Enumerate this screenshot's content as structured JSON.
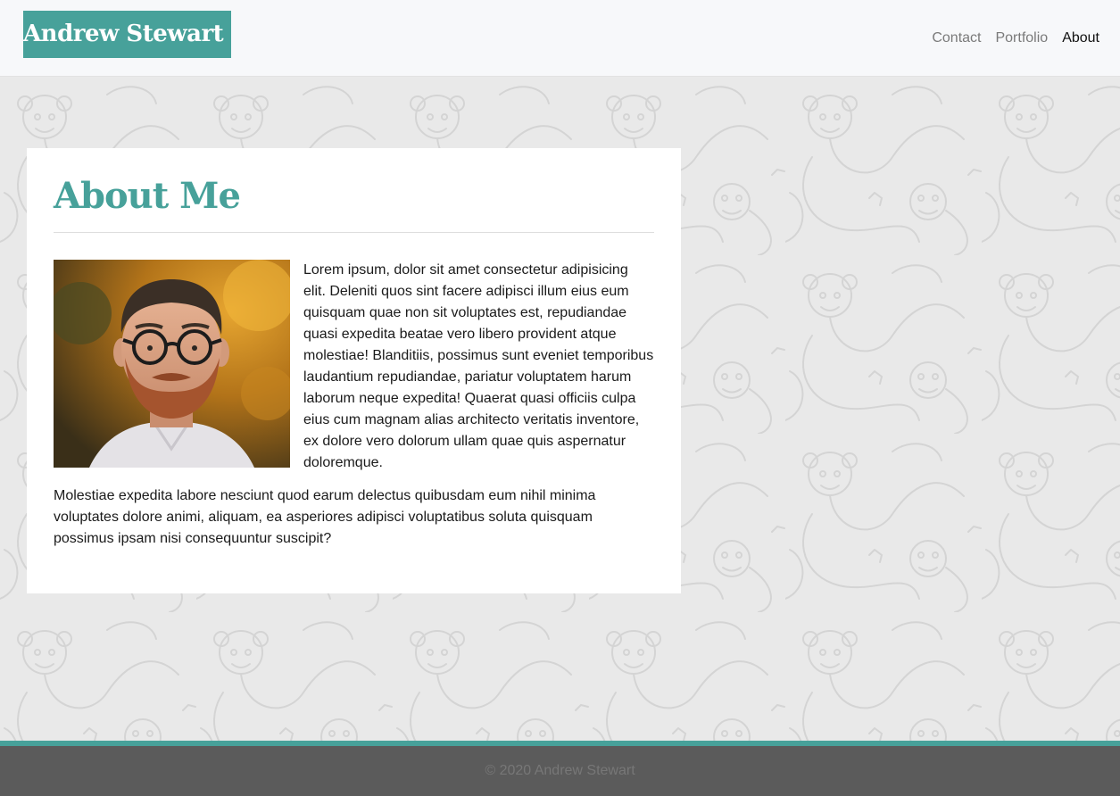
{
  "header": {
    "brand": "Andrew Stewart",
    "nav": [
      {
        "label": "Contact"
      },
      {
        "label": "Portfolio"
      },
      {
        "label": "About"
      }
    ],
    "active": "About"
  },
  "about": {
    "title": "About Me",
    "photo_alt": "Portrait of Andrew Stewart",
    "paragraphs": [
      "Lorem ipsum, dolor sit amet consectetur adipisicing elit. Deleniti quos sint facere adipisci illum eius eum quisquam quae non sit voluptates est, repudiandae quasi expedita beatae vero libero provident atque molestiae! Blanditiis, possimus sunt eveniet temporibus laudantium repudiandae, pariatur voluptatem harum laborum neque expedita! Quaerat quasi officiis culpa eius cum magnam alias architecto veritatis inventore, ex dolore vero dolorum ullam quae quis aspernatur doloremque.",
      "Molestiae expedita labore nesciunt quod earum delectus quibusdam eum nihil minima voluptates dolore animi, aliquam, ea asperiores adipisci voluptatibus soluta quisquam possimus ipsam nisi consequuntur suscipit?"
    ]
  },
  "footer": {
    "copyright": "© 2020 Andrew Stewart"
  },
  "colors": {
    "accent": "#47a19a",
    "navbar_bg": "#f7f8fa",
    "page_bg": "#e9e9e9",
    "footer_bg": "#5b5b5b",
    "footer_text": "#777777",
    "nav_inactive": "#7a7a7a",
    "nav_active": "#111111"
  }
}
